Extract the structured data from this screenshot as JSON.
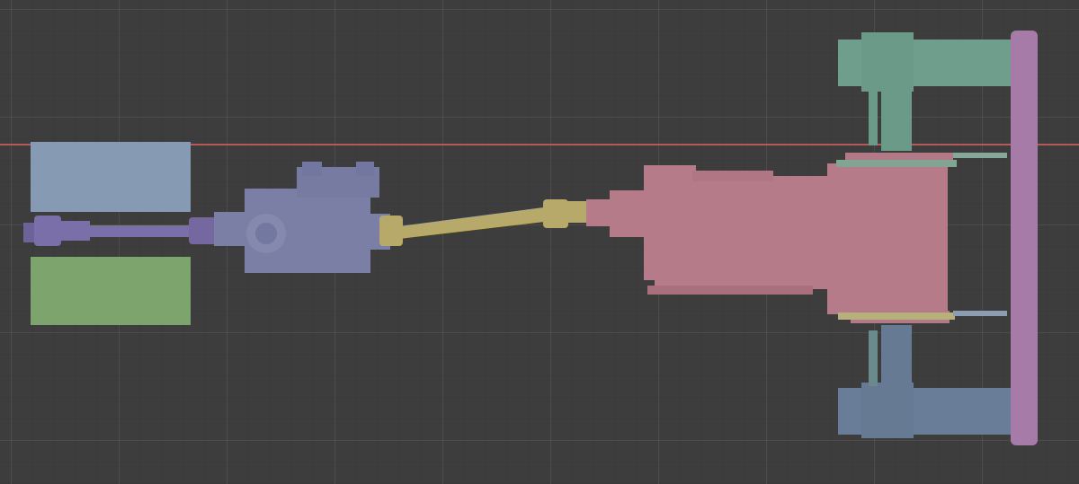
{
  "viewport": {
    "mode": "orthographic-top",
    "grid": true,
    "colors": {
      "background": "#3d3d3d",
      "x_axis_line": "#b35a5a",
      "grid_line": "#4e4e4e"
    }
  },
  "objects": [
    {
      "name": "blue-block",
      "color": "#879ab3"
    },
    {
      "name": "green-block",
      "color": "#7ea46e"
    },
    {
      "name": "input-shaft",
      "color": "#7a6fa8"
    },
    {
      "name": "transfer-gearbox",
      "color": "#7b7fa5"
    },
    {
      "name": "drive-shaft",
      "color": "#b7a96a"
    },
    {
      "name": "transmission-housing",
      "color": "#b67b88"
    },
    {
      "name": "front-wheel-upper",
      "color": "#6f9f8c"
    },
    {
      "name": "front-wheel-lower",
      "color": "#697d98"
    },
    {
      "name": "axle-bar",
      "color": "#a67ba8"
    }
  ]
}
